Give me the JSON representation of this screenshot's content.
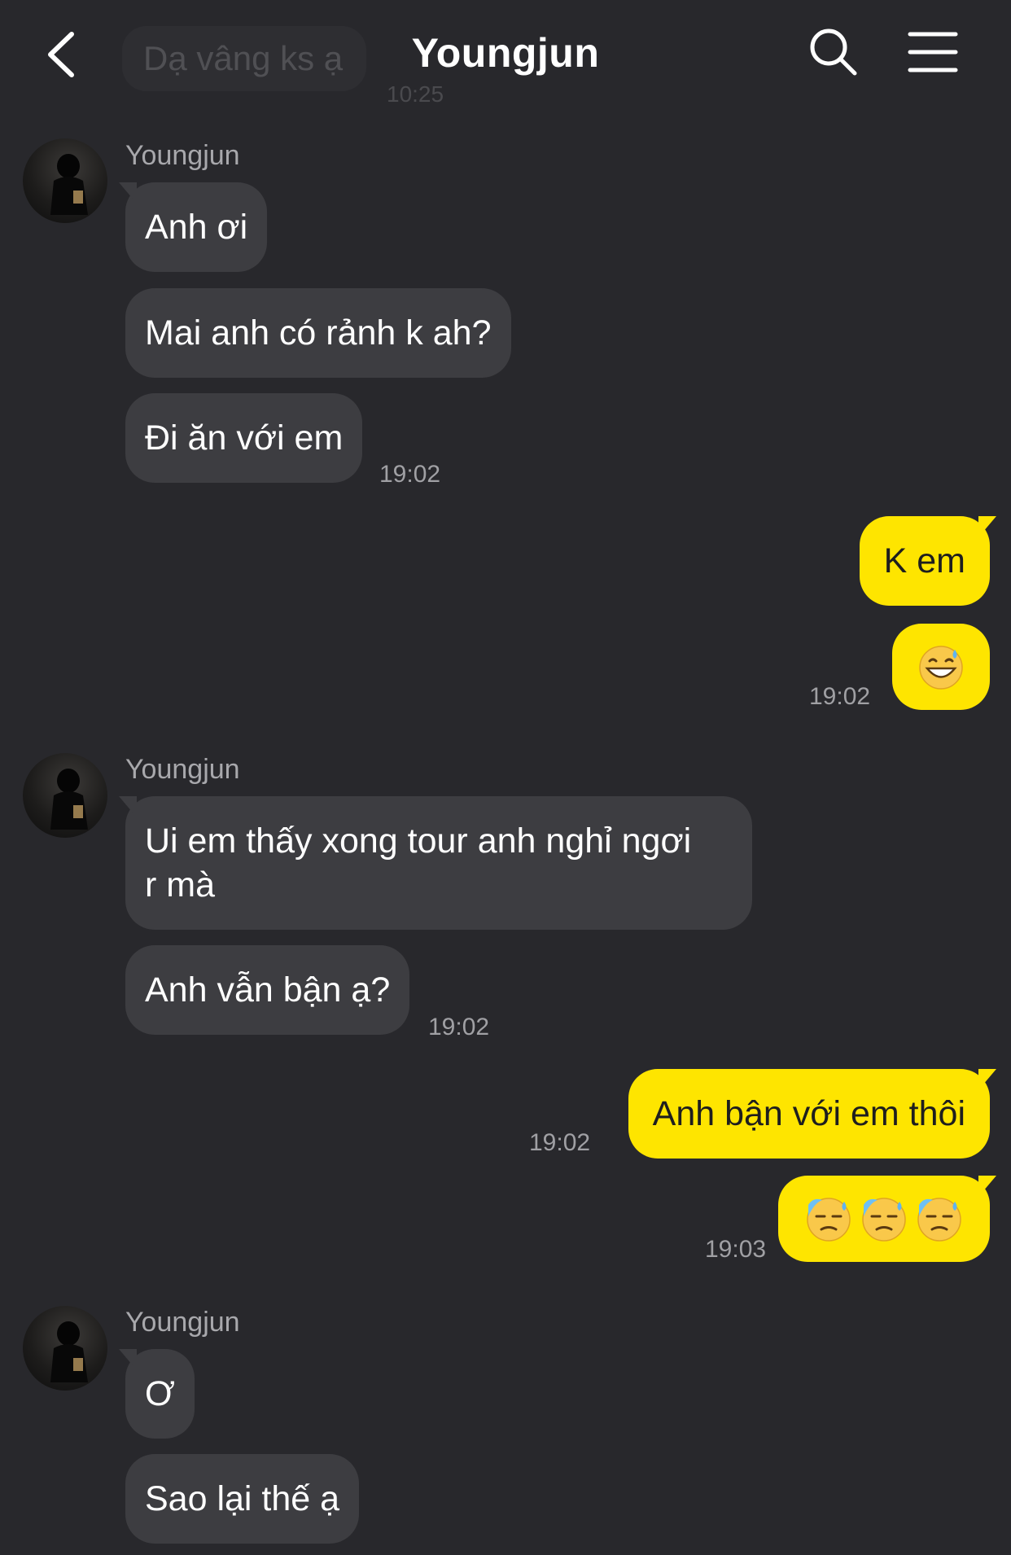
{
  "header": {
    "title": "Youngjun"
  },
  "previous_message": {
    "text": "Dạ vâng ks ạ",
    "time": "10:25"
  },
  "messages": [
    {
      "sender": "Youngjun",
      "texts": [
        "Anh ơi",
        "Mai anh có rảnh k ah?",
        "Đi ăn với em"
      ],
      "time": "19:02"
    },
    {
      "sender": "me",
      "texts": [
        "K em",
        "grinning-sweat-emoji"
      ],
      "time": "19:02"
    },
    {
      "sender": "Youngjun",
      "texts": [
        "Ui em thấy xong tour anh nghỉ ngơi r mà",
        "Anh vẫn bận ạ?"
      ],
      "time": "19:02"
    },
    {
      "sender": "me",
      "texts": [
        "Anh bận với em thôi"
      ],
      "time": "19:02"
    },
    {
      "sender": "me",
      "texts": [
        "downcast-sweat-emoji x3"
      ],
      "time": "19:03"
    },
    {
      "sender": "Youngjun",
      "texts": [
        "Ơ",
        "Sao lại thế ạ"
      ],
      "time": ""
    }
  ],
  "thread": {
    "g1": {
      "sender": "Youngjun",
      "m1": "Anh ơi",
      "m2": "Mai anh có rảnh k ah?",
      "m3": "Đi ăn với em",
      "time": "19:02"
    },
    "g2": {
      "m1": "K em",
      "time": "19:02"
    },
    "g3": {
      "sender": "Youngjun",
      "m1a": "Ui em thấy xong tour anh nghỉ ngơi",
      "m1b": "r mà",
      "m2": "Anh vẫn bận ạ?",
      "time": "19:02"
    },
    "g4": {
      "m1": "Anh bận với em thôi",
      "time": "19:02"
    },
    "g5": {
      "time": "19:03"
    },
    "g6": {
      "sender": "Youngjun",
      "m1": "Ơ",
      "m2": "Sao lại thế ạ"
    }
  },
  "colors": {
    "background": "#28282c",
    "incoming_bubble": "#3d3d41",
    "outgoing_bubble": "#fee500",
    "timestamp": "#a0a0a4"
  },
  "icons": [
    "back-icon",
    "search-icon",
    "menu-icon",
    "avatar",
    "grinning-sweat-emoji",
    "downcast-sweat-emoji"
  ]
}
